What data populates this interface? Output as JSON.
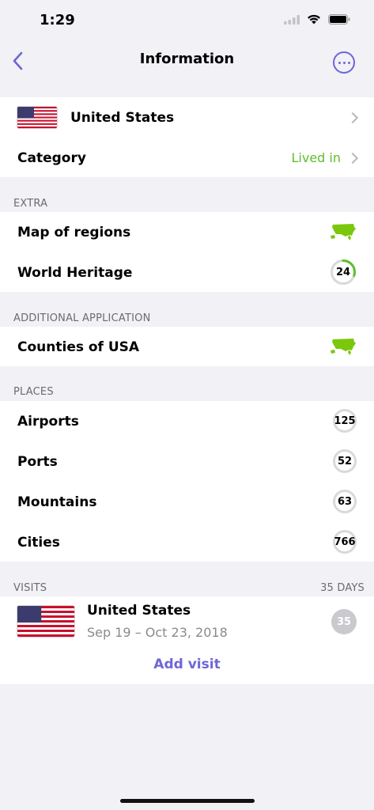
{
  "status_bar": {
    "time": "1:29"
  },
  "nav": {
    "title": "Information"
  },
  "country": {
    "name": "United States"
  },
  "category": {
    "label": "Category",
    "value": "Lived in"
  },
  "extra": {
    "header": "EXTRA",
    "map_regions": "Map of regions",
    "world_heritage": "World Heritage",
    "world_heritage_count": "24",
    "world_heritage_progress": 0.3
  },
  "additional": {
    "header": "ADDITIONAL APPLICATION",
    "counties": "Counties of USA"
  },
  "places": {
    "header": "PLACES",
    "items": [
      {
        "label": "Airports",
        "count": "125"
      },
      {
        "label": "Ports",
        "count": "52"
      },
      {
        "label": "Mountains",
        "count": "63"
      },
      {
        "label": "Cities",
        "count": "766"
      }
    ]
  },
  "visits": {
    "header": "VISITS",
    "total": "35 DAYS",
    "entry": {
      "country": "United States",
      "dates": "Sep 19 – Oct 23, 2018",
      "days": "35"
    },
    "add_label": "Add visit"
  },
  "colors": {
    "accent": "#6d66d6",
    "green": "#5cbf2a",
    "map_green": "#7ac70c"
  }
}
